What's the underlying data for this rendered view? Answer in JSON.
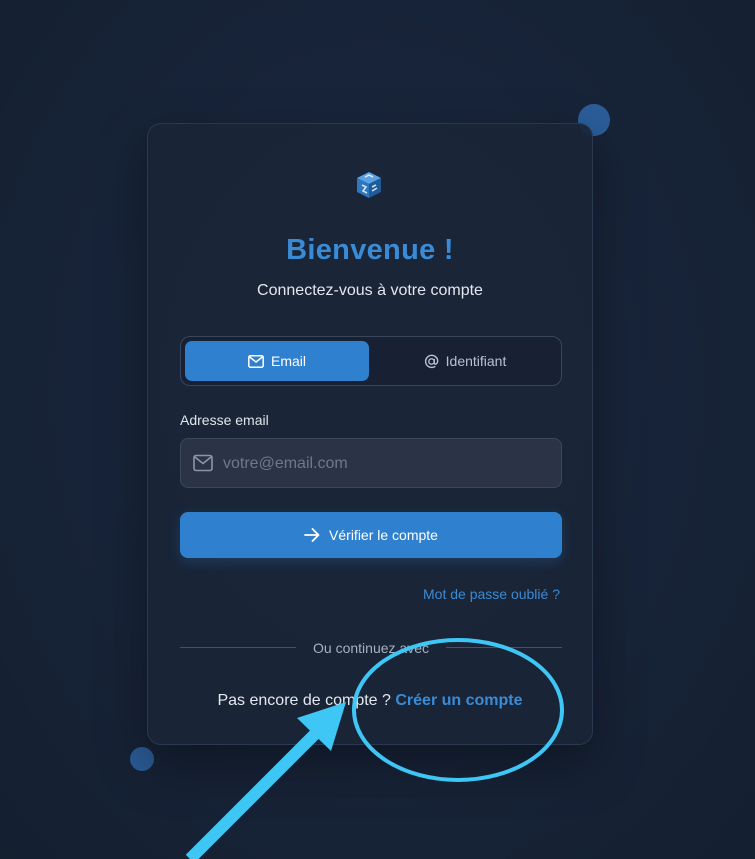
{
  "header": {
    "title": "Bienvenue !",
    "subtitle": "Connectez-vous à votre compte"
  },
  "tabs": [
    {
      "label": "Email",
      "icon": "mail-icon",
      "active": true
    },
    {
      "label": "Identifiant",
      "icon": "at-sign-icon",
      "active": false
    }
  ],
  "form": {
    "email_label": "Adresse email",
    "email_placeholder": "votre@email.com",
    "email_value": "",
    "submit_label": "Vérifier le compte",
    "forgot_label": "Mot de passe oublié ?"
  },
  "divider": {
    "text": "Ou continuez avec"
  },
  "signup": {
    "prompt": "Pas encore de compte ? ",
    "link_label": "Créer un compte"
  },
  "colors": {
    "accent": "#2f81d0",
    "accent_text": "#3a8bd6",
    "background": "#18243a",
    "card": "#1a2537",
    "annotation": "#3ec6f5"
  },
  "icons": {
    "logo": "cube-logo-icon",
    "input": "mail-icon",
    "submit": "arrow-right-icon"
  }
}
